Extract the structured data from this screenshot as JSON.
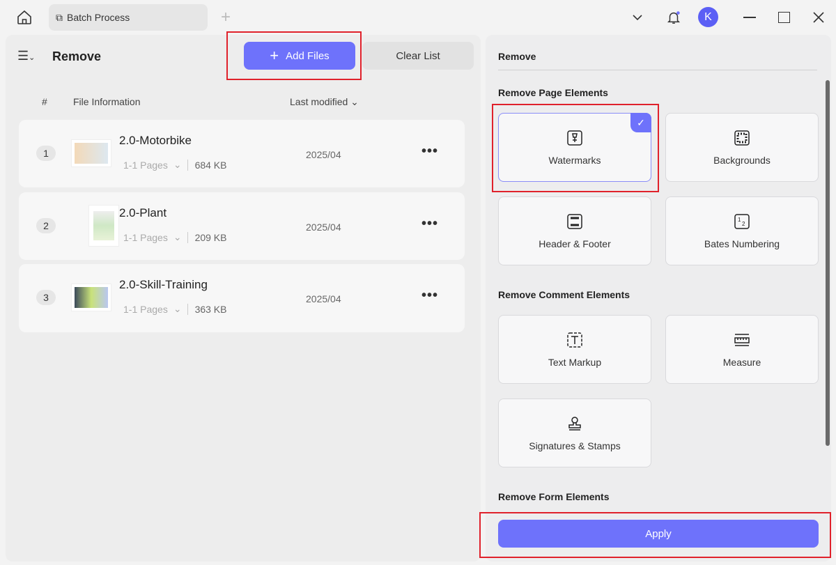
{
  "topbar": {
    "tab_title": "Batch Process",
    "avatar_letter": "K"
  },
  "left": {
    "title": "Remove",
    "add_files": "Add Files",
    "clear_list": "Clear List",
    "columns": {
      "index": "#",
      "file_info": "File Information",
      "last_modified": "Last modified"
    },
    "files": [
      {
        "index": "1",
        "name": "2.0-Motorbike",
        "pages": "1-1 Pages",
        "size": "684 KB",
        "date": "2025/04"
      },
      {
        "index": "2",
        "name": "2.0-Plant",
        "pages": "1-1 Pages",
        "size": "209 KB",
        "date": "2025/04"
      },
      {
        "index": "3",
        "name": "2.0-Skill-Training",
        "pages": "1-1 Pages",
        "size": "363 KB",
        "date": "2025/04"
      }
    ]
  },
  "right": {
    "title": "Remove",
    "page_section": "Remove Page Elements",
    "page_items": [
      {
        "label": "Watermarks",
        "icon": "watermark-icon",
        "selected": true
      },
      {
        "label": "Backgrounds",
        "icon": "background-icon"
      },
      {
        "label": "Header & Footer",
        "icon": "header-footer-icon"
      },
      {
        "label": "Bates Numbering",
        "icon": "bates-numbering-icon"
      }
    ],
    "comment_section": "Remove Comment Elements",
    "comment_items": [
      {
        "label": "Text Markup",
        "icon": "text-markup-icon"
      },
      {
        "label": "Measure",
        "icon": "measure-icon"
      },
      {
        "label": "Signatures & Stamps",
        "icon": "stamp-icon"
      }
    ],
    "form_section": "Remove Form Elements",
    "apply": "Apply"
  },
  "colors": {
    "accent": "#6e72fb",
    "annotation": "#e0212b"
  }
}
